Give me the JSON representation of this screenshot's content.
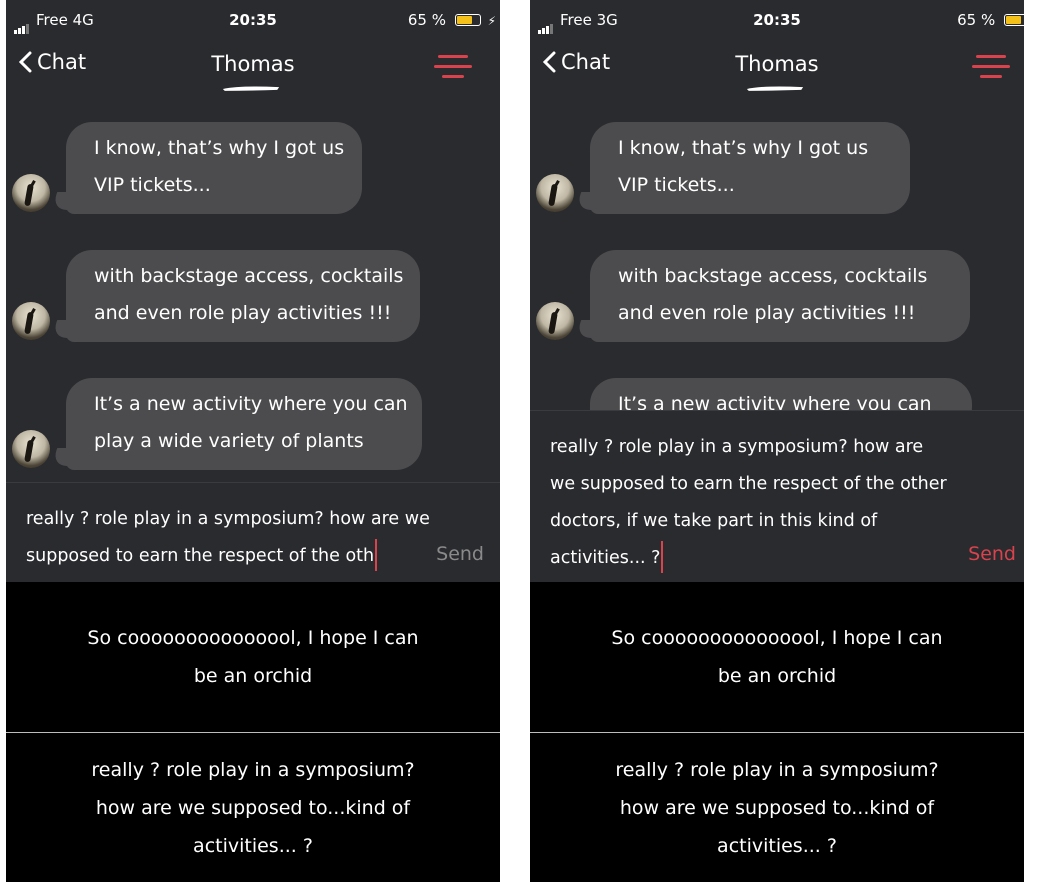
{
  "colors": {
    "accent": "#d9434d",
    "background": "#2a2b2f",
    "bubble": "#4c4c4e",
    "suggestion_bg": "#000000",
    "battery": "#f4c11b"
  },
  "screens": [
    {
      "status": {
        "carrier": "Free  4G",
        "time": "20:35",
        "battery": "65 %",
        "battery_level": 0.65,
        "charging": true
      },
      "nav": {
        "back_label": "Chat",
        "title": "Thomas"
      },
      "messages": [
        {
          "lines": [
            "I know, that’s why I got us",
            "VIP tickets..."
          ]
        },
        {
          "lines": [
            "with backstage access, cocktails",
            "and even role play activities !!!"
          ]
        },
        {
          "lines": [
            "It’s a new activity where you can",
            "play a wide variety of plants"
          ]
        }
      ],
      "compose": {
        "text": "really ? role play in a symposium? how are we supposed to earn the respect of the oth",
        "send_label": "Send",
        "send_active": false
      },
      "suggestions": [
        "So cooooooooooooool, I hope I can be an orchid",
        "really ? role play in a symposium? how are we supposed to...kind of activities... ?"
      ]
    },
    {
      "status": {
        "carrier": "Free  3G",
        "time": "20:35",
        "battery": "65 %",
        "battery_level": 0.65,
        "charging": false
      },
      "nav": {
        "back_label": "Chat",
        "title": "Thomas"
      },
      "messages": [
        {
          "lines": [
            "I know, that’s why I got us",
            "VIP tickets..."
          ]
        },
        {
          "lines": [
            "with backstage access, cocktails",
            "and even role play activities !!!"
          ]
        },
        {
          "lines": [
            "It’s a new activity where you can",
            ""
          ]
        }
      ],
      "compose": {
        "text": "really ? role play in a symposium? how are we supposed to earn the respect of the other doctors, if we take part in this kind of activities... ?",
        "send_label": "Send",
        "send_active": true
      },
      "suggestions": [
        "So cooooooooooooool, I hope I can be an orchid",
        "really ? role play in a symposium? how are we supposed to...kind of activities... ?"
      ]
    }
  ]
}
